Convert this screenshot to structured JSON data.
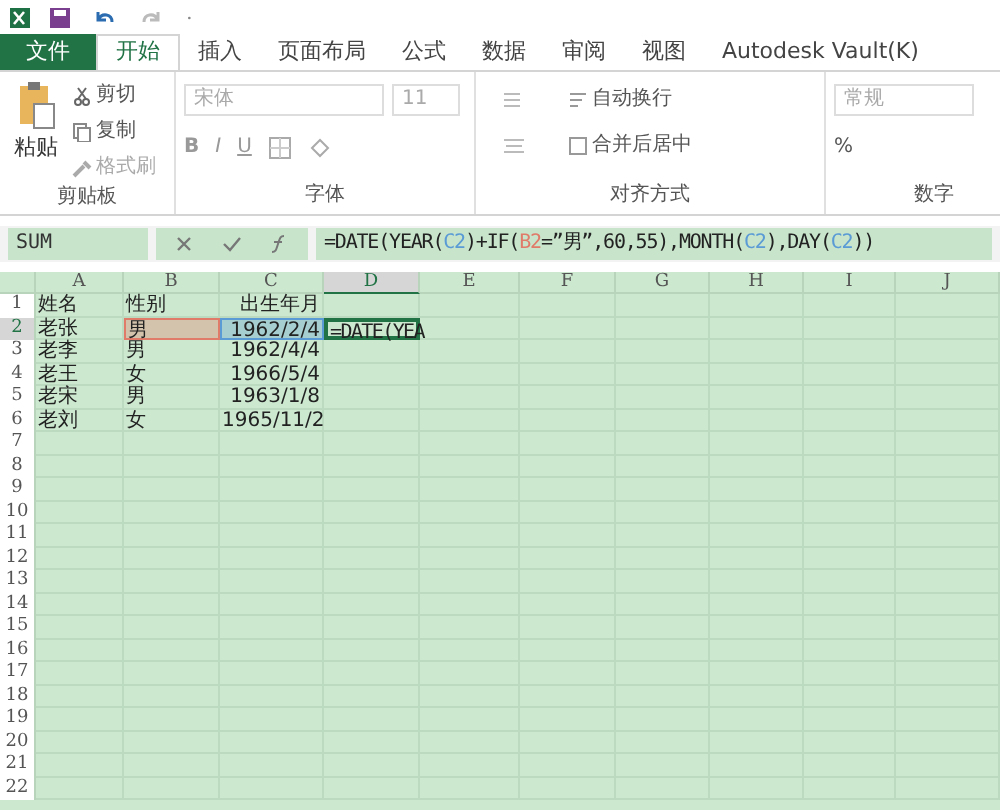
{
  "menu_tabs": [
    {
      "label": "文件",
      "kind": "file",
      "selected": false
    },
    {
      "label": "开始",
      "kind": "tab",
      "selected": true
    },
    {
      "label": "插入",
      "kind": "tab",
      "selected": false
    },
    {
      "label": "页面布局",
      "kind": "tab",
      "selected": false
    },
    {
      "label": "公式",
      "kind": "tab",
      "selected": false
    },
    {
      "label": "数据",
      "kind": "tab",
      "selected": false
    },
    {
      "label": "审阅",
      "kind": "tab",
      "selected": false
    },
    {
      "label": "视图",
      "kind": "tab",
      "selected": false
    },
    {
      "label": "Autodesk Vault(K)",
      "kind": "tab",
      "selected": false
    }
  ],
  "ribbon": {
    "clipboard": {
      "paste": "粘贴",
      "cut": "剪切",
      "copy": "复制",
      "format_painter": "格式刷",
      "label": "剪贴板"
    },
    "font": {
      "font_name": "宋体",
      "font_size": "11",
      "bold": "B",
      "italic": "I",
      "underline": "U",
      "label": "字体"
    },
    "alignment": {
      "wrap": "自动换行",
      "merge": "合并后居中",
      "label": "对齐方式"
    },
    "number": {
      "format": "常规",
      "percent": "%",
      "label": "数字"
    }
  },
  "formula_bar": {
    "name_box": "SUM",
    "formula": [
      {
        "text": "=DATE(YEAR("
      },
      {
        "text": "C2",
        "color": "#5b9bd5"
      },
      {
        "text": ")+IF("
      },
      {
        "text": "B2",
        "color": "#e07b6a"
      },
      {
        "text": "=”男”,60,55),MONTH("
      },
      {
        "text": "C2",
        "color": "#5b9bd5"
      },
      {
        "text": "),DAY("
      },
      {
        "text": "C2",
        "color": "#5b9bd5"
      },
      {
        "text": "))"
      }
    ]
  },
  "sheet": {
    "columns": [
      {
        "label": "A",
        "kind": "text",
        "selected": false
      },
      {
        "label": "B",
        "kind": "text",
        "selected": false
      },
      {
        "label": "C",
        "kind": "date",
        "selected": false
      },
      {
        "label": "D",
        "kind": "text",
        "selected": true
      },
      {
        "label": "E",
        "kind": "text",
        "selected": false
      },
      {
        "label": "F",
        "kind": "text",
        "selected": false
      },
      {
        "label": "G",
        "kind": "text",
        "selected": false
      },
      {
        "label": "H",
        "kind": "text",
        "selected": false
      },
      {
        "label": "I",
        "kind": "text",
        "selected": false
      },
      {
        "label": "J",
        "kind": "text",
        "selected": false
      }
    ],
    "rows": [
      {
        "number": "1",
        "selected": false,
        "cells": [
          "姓名",
          "性别",
          "出生年月"
        ]
      },
      {
        "number": "2",
        "selected": true,
        "cells": [
          "老张",
          {
            "text": "男",
            "color": "#e07b6a"
          },
          {
            "text": "1962/2/4",
            "color": "#5b9bd5"
          },
          {
            "text": "=DATE(YEA",
            "active": true
          }
        ]
      },
      {
        "number": "3",
        "selected": false,
        "cells": [
          "老李",
          "男",
          "1962/4/4"
        ]
      },
      {
        "number": "4",
        "selected": false,
        "cells": [
          "老王",
          "女",
          "1966/5/4"
        ]
      },
      {
        "number": "5",
        "selected": false,
        "cells": [
          "老宋",
          "男",
          "1963/1/8"
        ]
      },
      {
        "number": "6",
        "selected": false,
        "cells": [
          "老刘",
          "女",
          "1965/11/2"
        ]
      },
      {
        "number": "7",
        "selected": false,
        "cells": []
      },
      {
        "number": "8",
        "selected": false,
        "cells": []
      },
      {
        "number": "9",
        "selected": false,
        "cells": []
      },
      {
        "number": "10",
        "selected": false,
        "cells": []
      },
      {
        "number": "11",
        "selected": false,
        "cells": []
      },
      {
        "number": "12",
        "selected": false,
        "cells": []
      },
      {
        "number": "13",
        "selected": false,
        "cells": []
      },
      {
        "number": "14",
        "selected": false,
        "cells": []
      },
      {
        "number": "15",
        "selected": false,
        "cells": []
      },
      {
        "number": "16",
        "selected": false,
        "cells": []
      },
      {
        "number": "17",
        "selected": false,
        "cells": []
      },
      {
        "number": "18",
        "selected": false,
        "cells": []
      },
      {
        "number": "19",
        "selected": false,
        "cells": []
      },
      {
        "number": "20",
        "selected": false,
        "cells": []
      },
      {
        "number": "21",
        "selected": false,
        "cells": []
      },
      {
        "number": "22",
        "selected": false,
        "cells": []
      }
    ]
  }
}
